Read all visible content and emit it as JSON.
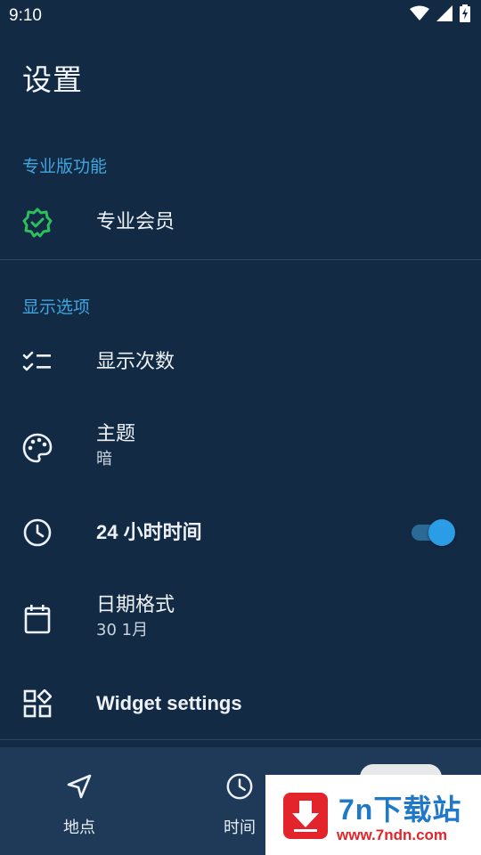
{
  "status_bar": {
    "time": "9:10"
  },
  "page": {
    "title": "设置"
  },
  "sections": {
    "pro": {
      "header": "专业版功能",
      "member_label": "专业会员"
    },
    "display": {
      "header": "显示选项",
      "show_count_label": "显示次数",
      "theme_label": "主题",
      "theme_value": "暗",
      "time24_label": "24 小时时间",
      "time24_enabled": true,
      "date_format_label": "日期格式",
      "date_format_value": "30 1月",
      "widget_settings_label": "Widget settings"
    }
  },
  "bottom_nav": {
    "items": [
      {
        "label": "地点",
        "icon": "navigation-arrow-icon"
      },
      {
        "label": "时间",
        "icon": "clock-icon"
      }
    ]
  },
  "watermark": {
    "title": "7n下载站",
    "url": "www.7ndn.com"
  },
  "colors": {
    "background": "#132a45",
    "accent": "#3fa6df",
    "toggle_on": "#2a9de6",
    "verified_green": "#2dbf5a"
  }
}
